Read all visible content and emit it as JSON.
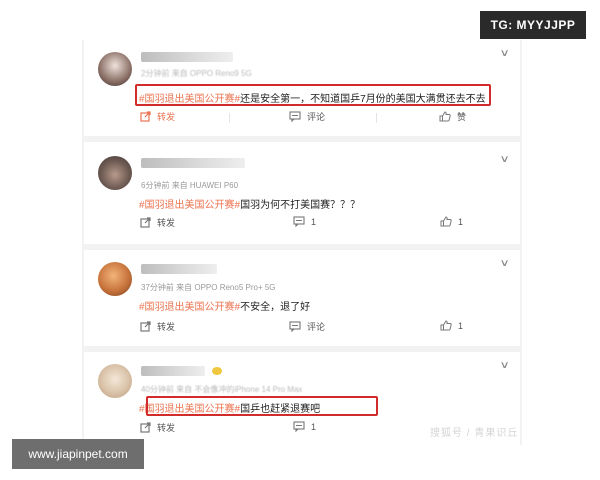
{
  "watermarks": {
    "top_right": "TG: MYYJJPP",
    "bottom_left": "www.jiapinpet.com",
    "bottom_right_faint": "搜狐号 / 青果识丘"
  },
  "posts": [
    {
      "time": "2分钟前",
      "source": "来自 OPPO Reno9 5G",
      "topic": "#国羽退出美国公开赛#",
      "content": "还是安全第一，不知道国乒7月份的美国大满贯还去不去",
      "highlighted": true,
      "actions": {
        "repost": "转发",
        "comment": "评论",
        "like": "赞"
      }
    },
    {
      "time": "6分钟前",
      "source": "来自 HUAWEI P60",
      "topic": "#国羽退出美国公开赛#",
      "content": "国羽为何不打美国赛？？？",
      "highlighted": false,
      "actions": {
        "repost": "转发",
        "comment": "1",
        "like": "1"
      }
    },
    {
      "time": "37分钟前",
      "source": "来自 OPPO Reno5 Pro+ 5G",
      "topic": "#国羽退出美国公开赛#",
      "content": "不安全，退了好",
      "highlighted": false,
      "actions": {
        "repost": "转发",
        "comment": "评论",
        "like": "1"
      }
    },
    {
      "time": "40分钟前",
      "source": "来自 不会像冲的iPhone 14 Pro Max",
      "topic": "#国羽退出美国公开赛#",
      "content": "国乒也赶紧退赛吧",
      "highlighted": true,
      "actions": {
        "repost": "转发",
        "comment": "1",
        "like": ""
      }
    }
  ],
  "colors": {
    "topic": "#eb7350",
    "highlight_box": "#d22b2b",
    "card_bg": "#ffffff",
    "feed_bg": "#f2f2f2"
  }
}
